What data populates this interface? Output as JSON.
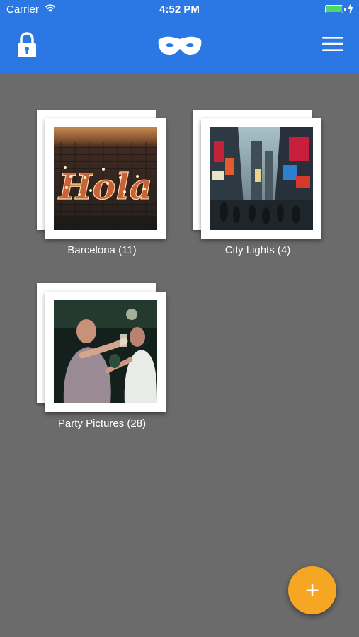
{
  "status_bar": {
    "carrier": "Carrier",
    "time": "4:52 PM",
    "battery_level": 1.0
  },
  "nav": {
    "left_icon": "lock-icon",
    "logo_icon": "mask-icon",
    "right_icon": "hamburger-menu-icon"
  },
  "albums": [
    {
      "name": "Barcelona (11)",
      "thumbnail": "hola-neon-sign-photo"
    },
    {
      "name": "City Lights (4)",
      "thumbnail": "city-street-night-photo"
    },
    {
      "name": "Party Pictures (28)",
      "thumbnail": "party-people-photo"
    }
  ],
  "fab": {
    "label": "+"
  },
  "colors": {
    "header": "#2b78e4",
    "background": "#6b6b6b",
    "fab": "#f5a623"
  }
}
